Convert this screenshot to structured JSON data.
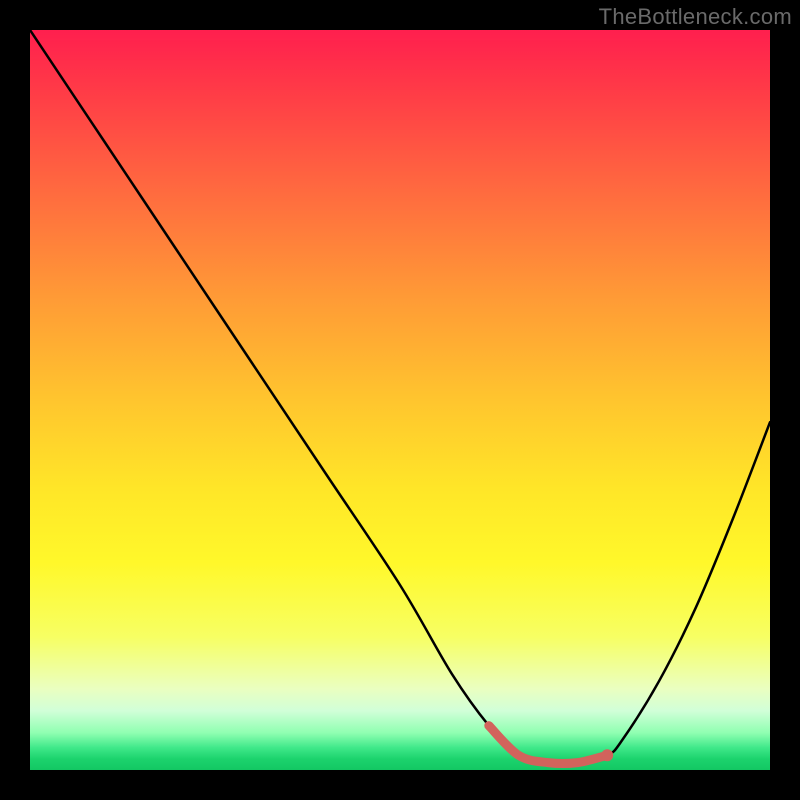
{
  "watermark": "TheBottleneck.com",
  "chart_data": {
    "type": "line",
    "title": "",
    "xlabel": "",
    "ylabel": "",
    "xlim": [
      0,
      100
    ],
    "ylim": [
      0,
      100
    ],
    "series": [
      {
        "name": "bottleneck-curve",
        "x": [
          0,
          10,
          20,
          30,
          40,
          50,
          57,
          62,
          66,
          70,
          74,
          78,
          80,
          85,
          90,
          95,
          100
        ],
        "values": [
          100,
          85,
          70,
          55,
          40,
          25,
          13,
          6,
          2,
          1,
          1,
          2,
          4,
          12,
          22,
          34,
          47
        ]
      }
    ],
    "highlight_segment": {
      "name": "optimal-range",
      "x": [
        62,
        66,
        70,
        74,
        78
      ],
      "values": [
        6,
        2,
        1,
        1,
        2
      ]
    },
    "highlight_point": {
      "x": 78,
      "value": 2
    },
    "gradient_stops": [
      {
        "pos": 0,
        "color": "#ff1f4e"
      },
      {
        "pos": 0.5,
        "color": "#ffc52e"
      },
      {
        "pos": 0.72,
        "color": "#fff82a"
      },
      {
        "pos": 0.92,
        "color": "#d1ffd8"
      },
      {
        "pos": 1.0,
        "color": "#13c763"
      }
    ],
    "curve_stroke": "#000000",
    "highlight_stroke": "#d2635c"
  }
}
